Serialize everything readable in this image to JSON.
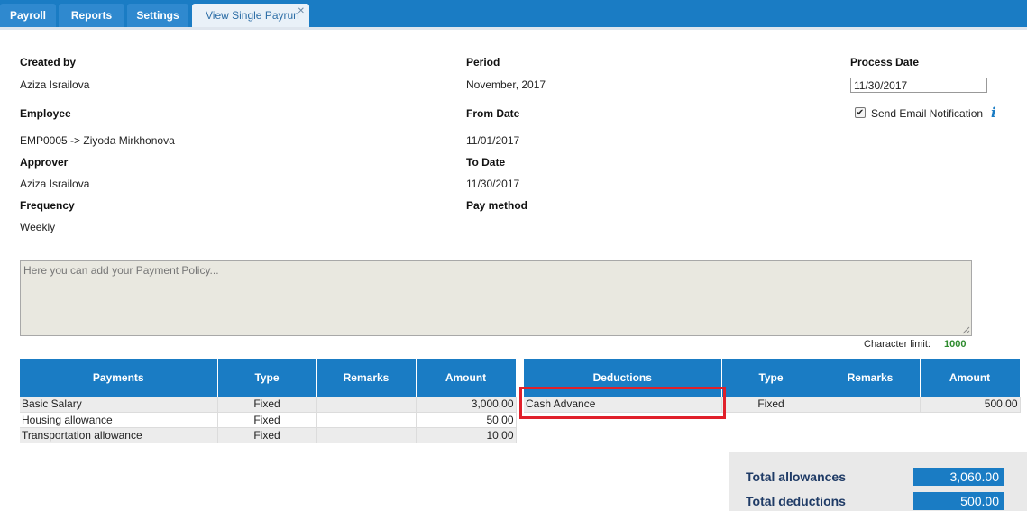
{
  "tabs": [
    {
      "label": "Payroll"
    },
    {
      "label": "Reports"
    },
    {
      "label": "Settings"
    },
    {
      "label": "View Single Payrun",
      "active": true
    }
  ],
  "fields": {
    "created_by_label": "Created by",
    "created_by_value": "Aziza Israilova",
    "employee_label": "Employee",
    "employee_value": "EMP0005 -> Ziyoda Mirkhonova",
    "approver_label": "Approver",
    "approver_value": "Aziza Israilova",
    "frequency_label": "Frequency",
    "frequency_value": "Weekly",
    "period_label": "Period",
    "period_value": "November, 2017",
    "from_date_label": "From Date",
    "from_date_value": "11/01/2017",
    "to_date_label": "To Date",
    "to_date_value": "11/30/2017",
    "pay_method_label": "Pay method",
    "process_date_label": "Process Date",
    "process_date_value": "11/30/2017",
    "send_email_label": "Send Email Notification",
    "send_email_checked": true
  },
  "policy": {
    "placeholder": "Here you can add your Payment Policy...",
    "char_limit_label": "Character limit:",
    "char_limit_value": "1000"
  },
  "payments": {
    "headers": [
      "Payments",
      "Type",
      "Remarks",
      "Amount"
    ],
    "rows": [
      {
        "name": "Basic Salary",
        "type": "Fixed",
        "remarks": "",
        "amount": "3,000.00"
      },
      {
        "name": "Housing allowance",
        "type": "Fixed",
        "remarks": "",
        "amount": "50.00"
      },
      {
        "name": "Transportation allowance",
        "type": "Fixed",
        "remarks": "",
        "amount": "10.00"
      }
    ]
  },
  "deductions": {
    "headers": [
      "Deductions",
      "Type",
      "Remarks",
      "Amount"
    ],
    "rows": [
      {
        "name": "Cash Advance",
        "type": "Fixed",
        "remarks": "",
        "amount": "500.00"
      }
    ]
  },
  "totals": {
    "allowances_label": "Total allowances",
    "allowances_value": "3,060.00",
    "deductions_label": "Total deductions",
    "deductions_value": "500.00"
  },
  "colors": {
    "primary": "#1a7cc4",
    "highlight": "#e0202a",
    "char_limit": "#2e8b2e"
  }
}
